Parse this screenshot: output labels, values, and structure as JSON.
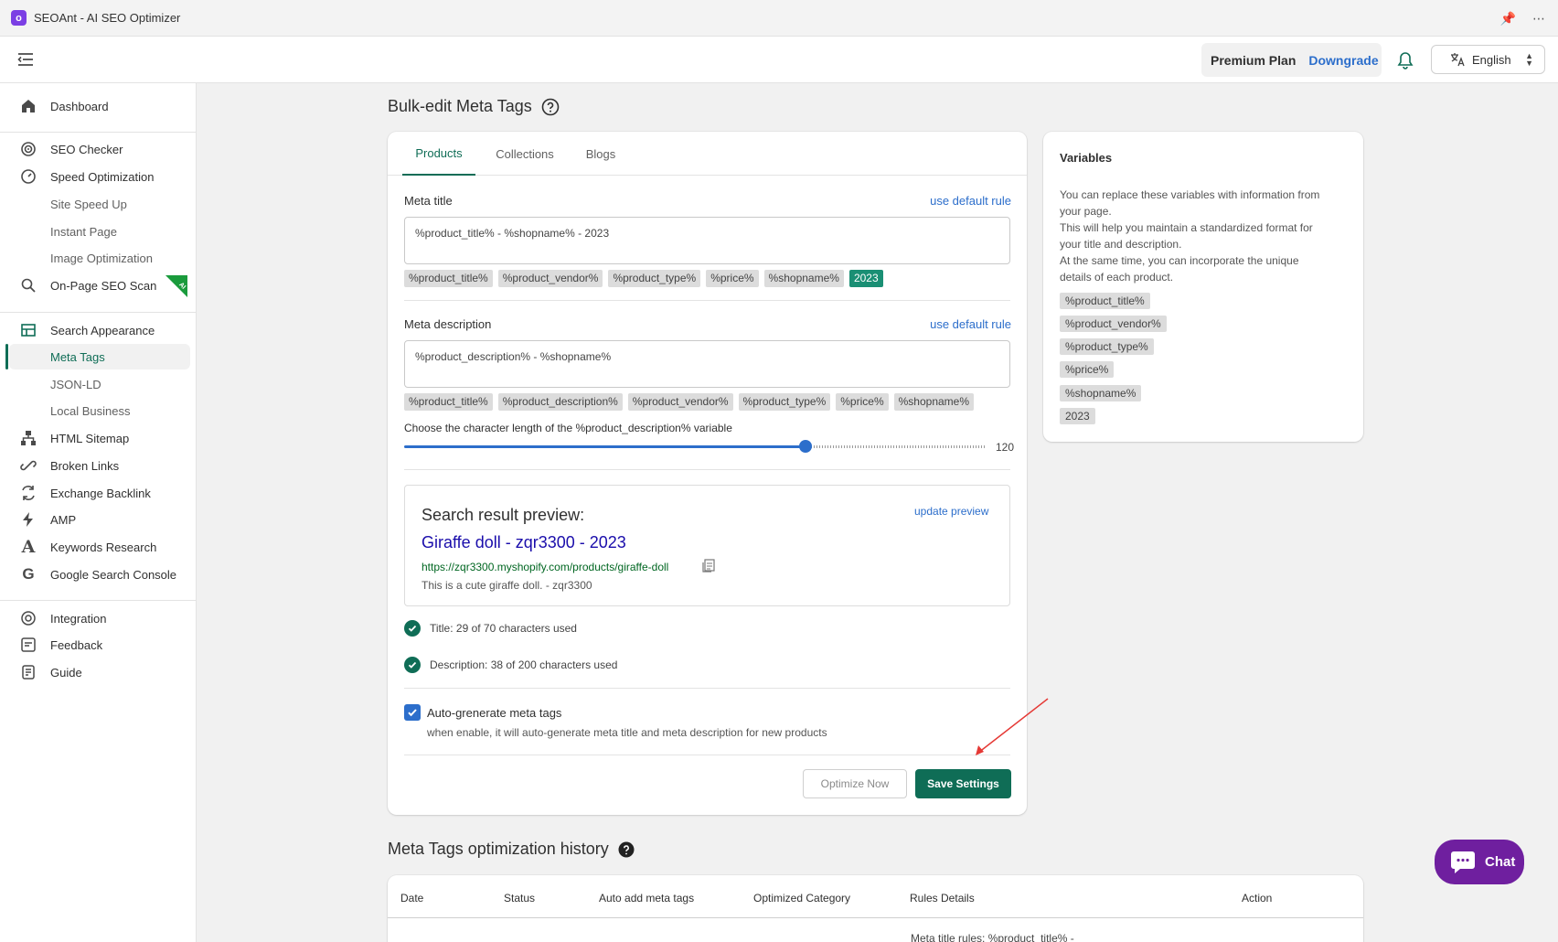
{
  "window": {
    "app_title": "SEOAnt - AI SEO Optimizer",
    "logo_letter": "o"
  },
  "header": {
    "plan_name": "Premium Plan",
    "downgrade_label": "Downgrade",
    "language": "English"
  },
  "sidebar": {
    "items": [
      {
        "label": "Dashboard",
        "icon": "home-icon"
      },
      {
        "label": "SEO Checker",
        "icon": "target-icon"
      },
      {
        "label": "Speed Optimization",
        "icon": "speedometer-icon"
      },
      {
        "label": "Site Speed Up",
        "icon": ""
      },
      {
        "label": "Instant Page",
        "icon": ""
      },
      {
        "label": "Image Optimization",
        "icon": ""
      },
      {
        "label": "On-Page SEO Scan",
        "icon": "search-icon",
        "badge": "AI"
      },
      {
        "label": "Search Appearance",
        "icon": "table-icon"
      },
      {
        "label": "Meta Tags",
        "icon": "",
        "active": true
      },
      {
        "label": "JSON-LD",
        "icon": ""
      },
      {
        "label": "Local Business",
        "icon": ""
      },
      {
        "label": "HTML Sitemap",
        "icon": "sitemap-icon"
      },
      {
        "label": "Broken Links",
        "icon": "link-icon"
      },
      {
        "label": "Exchange Backlink",
        "icon": "exchange-icon"
      },
      {
        "label": "AMP",
        "icon": "bolt-icon"
      },
      {
        "label": "Keywords Research",
        "icon": "letter-a-icon"
      },
      {
        "label": "Google Search Console",
        "icon": "google-icon"
      },
      {
        "label": "Integration",
        "icon": "integration-icon"
      },
      {
        "label": "Feedback",
        "icon": "feedback-icon"
      },
      {
        "label": "Guide",
        "icon": "guide-icon"
      }
    ]
  },
  "page": {
    "title": "Bulk-edit Meta Tags"
  },
  "tabs": [
    "Products",
    "Collections",
    "Blogs"
  ],
  "meta_title": {
    "label": "Meta title",
    "default_rule_link": "use default rule",
    "value": "%product_title% - %shopname% - 2023",
    "chips": [
      "%product_title%",
      "%product_vendor%",
      "%product_type%",
      "%price%",
      "%shopname%",
      "2023"
    ]
  },
  "meta_description": {
    "label": "Meta description",
    "default_rule_link": "use default rule",
    "value": "%product_description% - %shopname%",
    "chips": [
      "%product_title%",
      "%product_description%",
      "%product_vendor%",
      "%product_type%",
      "%price%",
      "%shopname%"
    ],
    "slider_label": "Choose the character length of the %product_description% variable",
    "slider_value": "120",
    "slider_fraction": 0.69
  },
  "preview": {
    "heading": "Search result preview:",
    "update_link": "update preview",
    "result_title": "Giraffe doll - zqr3300 - 2023",
    "result_url": "https://zqr3300.myshopify.com/products/giraffe-doll",
    "result_desc": "This is a cute giraffe doll. - zqr3300"
  },
  "checks": {
    "title_check": "Title: 29 of 70 characters used",
    "description_check": "Description: 38 of 200 characters used"
  },
  "auto_generate": {
    "label": "Auto-grenerate meta tags",
    "help": "when enable, it will auto-generate meta title and meta description for new products",
    "checked": true
  },
  "actions": {
    "optimize_label": "Optimize Now",
    "save_label": "Save Settings"
  },
  "variables_panel": {
    "title": "Variables",
    "desc_lines": [
      "You can replace these variables with information from",
      "your page.",
      "This will help you maintain a standardized format for",
      "your title and description.",
      "At the same time, you can incorporate the unique",
      "details of each product."
    ],
    "chips": [
      "%product_title%",
      "%product_vendor%",
      "%product_type%",
      "%price%",
      "%shopname%",
      "2023"
    ]
  },
  "history": {
    "title": "Meta Tags optimization history",
    "columns": [
      "Date",
      "Status",
      "Auto add meta tags",
      "Optimized Category",
      "Rules Details",
      "Action"
    ],
    "partial_row_text": "Meta title rules: %product_title% -"
  },
  "chat": {
    "label": "Chat"
  },
  "colors": {
    "accent": "#0f6d56",
    "link": "#2c6ecb",
    "chat": "#6f1f9f",
    "arrow": "#e53935"
  }
}
